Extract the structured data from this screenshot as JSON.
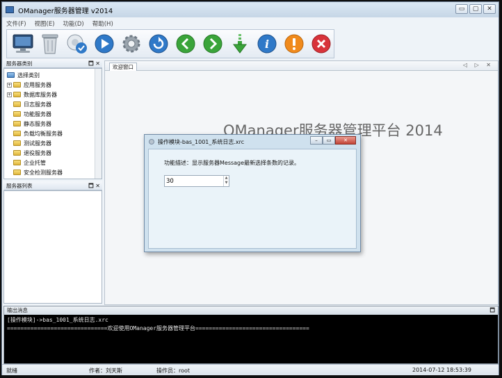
{
  "window": {
    "title": "OManager服务器管理 v2014",
    "controls": [
      "▭",
      "▢",
      "✕"
    ]
  },
  "menu": [
    "文件(F)",
    "视图(E)",
    "功能(D)",
    "帮助(H)"
  ],
  "toolbar": {
    "icons": [
      "monitor-icon",
      "trash-icon",
      "connect-icon",
      "play-icon",
      "settings-gear-icon",
      "refresh-icon",
      "back-icon",
      "forward-icon",
      "download-icon",
      "info-icon",
      "warning-icon",
      "close-icon"
    ],
    "colors": {
      "blue": "#2f79c8",
      "green": "#3aa43a",
      "orange": "#f08a1c",
      "red": "#d8333a",
      "gray": "#9aa4ad"
    }
  },
  "category_panel": {
    "title": "服务器类别",
    "root": "选择类别",
    "items": [
      {
        "label": "应用服务器",
        "expandable": true
      },
      {
        "label": "数据库服务器",
        "expandable": true
      },
      {
        "label": "日志服务器",
        "expandable": false
      },
      {
        "label": "功能服务器",
        "expandable": false
      },
      {
        "label": "静态服务器",
        "expandable": false
      },
      {
        "label": "负载均衡服务器",
        "expandable": false
      },
      {
        "label": "测试服务器",
        "expandable": false
      },
      {
        "label": "退役服务器",
        "expandable": false
      },
      {
        "label": "企业托管",
        "expandable": false
      },
      {
        "label": "安全检测服务器",
        "expandable": false
      }
    ]
  },
  "server_list_panel": {
    "title": "服务器列表"
  },
  "panel_controls": "🗖 ✕",
  "tab": {
    "label": "欢迎窗口",
    "controls": "◁ ▷ ✕"
  },
  "watermark": "OManager服务器管理平台 2014",
  "dialog": {
    "title": "操作模块-bas_1001_系统日志.xrc",
    "description": "功能描述：显示服务器Message最新选择条数的记录。",
    "value": "30"
  },
  "output": {
    "title": "输出消息",
    "lines": [
      "[操作模块]->bas_1001_系统日志.xrc",
      "==============================欢迎使用OManager服务器管理平台=================================="
    ]
  },
  "status": {
    "state": "就绪",
    "author": "作者：刘天斯",
    "operator": "操作员：root",
    "datetime": "2014-07-12 18:53:39"
  }
}
